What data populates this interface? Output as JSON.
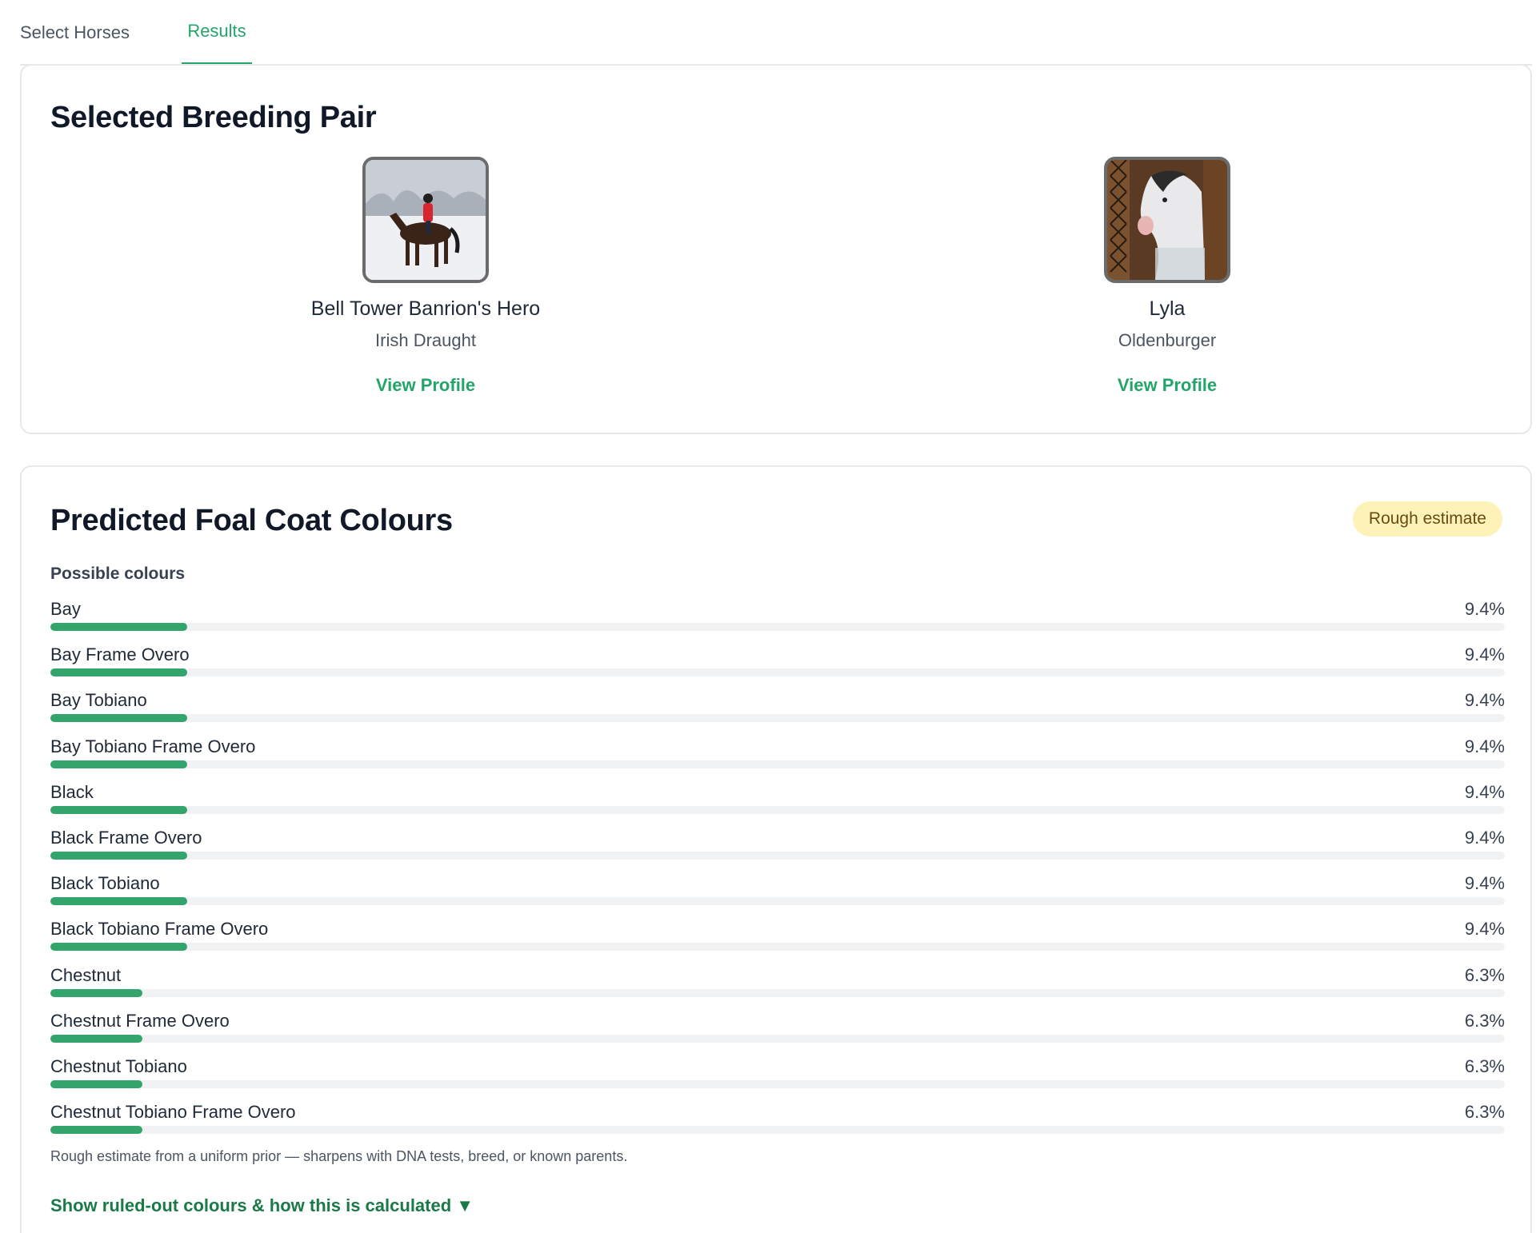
{
  "tabs": [
    {
      "label": "Select Horses",
      "active": false
    },
    {
      "label": "Results",
      "active": true
    }
  ],
  "pair": {
    "title": "Selected Breeding Pair",
    "horses": [
      {
        "name": "Bell Tower Banrion's Hero",
        "breed": "Irish Draught",
        "link": "View Profile",
        "photo_icon": "rider-in-snow-photo"
      },
      {
        "name": "Lyla",
        "breed": "Oldenburger",
        "link": "View Profile",
        "photo_icon": "horse-head-photo"
      }
    ]
  },
  "foal": {
    "title": "Predicted Foal Coat Colours",
    "badge": "Rough estimate",
    "subtitle": "Possible colours",
    "note": "Rough estimate from a uniform prior — sharpens with DNA tests, breed, or known parents.",
    "toggle": "Show ruled-out colours & how this is calculated ▼",
    "colours": [
      {
        "label": "Bay",
        "pct": "9.4%",
        "value": 9.4
      },
      {
        "label": "Bay Frame Overo",
        "pct": "9.4%",
        "value": 9.4
      },
      {
        "label": "Bay Tobiano",
        "pct": "9.4%",
        "value": 9.4
      },
      {
        "label": "Bay Tobiano Frame Overo",
        "pct": "9.4%",
        "value": 9.4
      },
      {
        "label": "Black",
        "pct": "9.4%",
        "value": 9.4
      },
      {
        "label": "Black Frame Overo",
        "pct": "9.4%",
        "value": 9.4
      },
      {
        "label": "Black Tobiano",
        "pct": "9.4%",
        "value": 9.4
      },
      {
        "label": "Black Tobiano Frame Overo",
        "pct": "9.4%",
        "value": 9.4
      },
      {
        "label": "Chestnut",
        "pct": "6.3%",
        "value": 6.3
      },
      {
        "label": "Chestnut Frame Overo",
        "pct": "6.3%",
        "value": 6.3
      },
      {
        "label": "Chestnut Tobiano",
        "pct": "6.3%",
        "value": 6.3
      },
      {
        "label": "Chestnut Tobiano Frame Overo",
        "pct": "6.3%",
        "value": 6.3
      }
    ]
  },
  "colors": {
    "accent": "#23a468",
    "bar": "#33a46b",
    "badge_bg": "#fdf3b9",
    "link_dark": "#1a7a47"
  }
}
